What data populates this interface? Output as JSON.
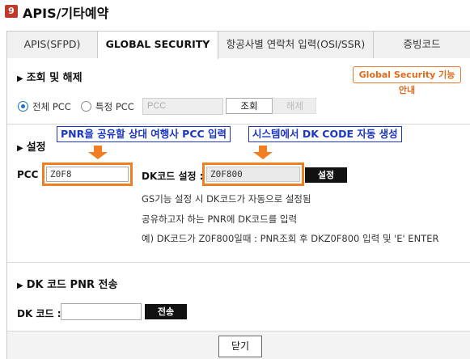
{
  "window": {
    "badge": "9",
    "title": "APIS/기타예약"
  },
  "tabs": [
    {
      "label": "APIS(SFPD)",
      "active": false
    },
    {
      "label": "GLOBAL SECURITY",
      "active": true
    },
    {
      "label": "항공사별 연락처 입력(OSI/SSR)",
      "active": false
    },
    {
      "label": "증빙코드",
      "active": false
    }
  ],
  "inquiry": {
    "title": "조회 및 해제",
    "guide_button": "Global Security 기능 안내",
    "radio_all": "전체 PCC",
    "radio_specific": "특정 PCC",
    "selected": "all",
    "pcc_placeholder": "PCC",
    "search_button": "조회",
    "release_button": "해제"
  },
  "settings": {
    "title": "설정",
    "pcc_label": "PCC :",
    "pcc_value": "Z0F8",
    "dk_label": "DK코드 설정 :",
    "dk_value": "Z0F800",
    "set_button": "설정",
    "callout_pcc": "PNR을 공유할 상대 여행사 PCC 입력",
    "callout_dk": "시스템에서 DK CODE 자동 생성",
    "notes": [
      "GS기능 설정 시 DK코드가 자동으로 설정됨",
      "공유하고자 하는 PNR에 DK코드를 입력",
      "예) DK코드가 Z0F800일때 : PNR조회 후 DKZ0F800 입력 및 'E' ENTER"
    ]
  },
  "transfer": {
    "title": "DK 코드 PNR 전송",
    "dk_label": "DK 코드 :",
    "dk_value": "",
    "send_button": "전송"
  },
  "footer": {
    "close_button": "닫기"
  },
  "colors": {
    "accent_orange": "#f07e22",
    "callout_blue": "#1c36c9",
    "radio_blue": "#1a73c9",
    "badge_red": "#c0392b"
  }
}
